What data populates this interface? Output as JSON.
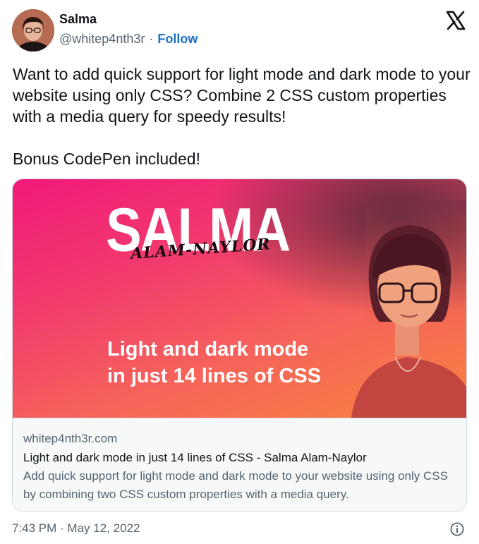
{
  "author": {
    "name": "Salma",
    "handle": "@whitep4nth3r",
    "separator": "·",
    "follow_label": "Follow"
  },
  "tweet": {
    "paragraphs": [
      "Want to add quick support for light mode and dark mode to your website using only CSS? Combine 2 CSS custom properties with a media query for speedy results!",
      "Bonus CodePen included!"
    ],
    "timestamp": "7:43 PM · May 12, 2022"
  },
  "card": {
    "image": {
      "brand_name": "SALMA",
      "brand_sub": "ALAM-NAYLOR",
      "headline_line1": "Light and dark mode",
      "headline_line2": "in just 14 lines of CSS"
    },
    "domain": "whitep4nth3r.com",
    "title": "Light and dark mode in just 14 lines of CSS - Salma Alam-Naylor",
    "description": "Add quick support for light mode and dark mode to your website using only CSS by combining two CSS custom properties with a media query."
  },
  "icons": {
    "platform_logo": "x-logo-icon",
    "info": "info-icon"
  },
  "colors": {
    "follow_link": "#1d6fc4",
    "secondary_text": "#536471",
    "card_gradient_start": "#f0197a",
    "card_gradient_end": "#f8843f"
  }
}
